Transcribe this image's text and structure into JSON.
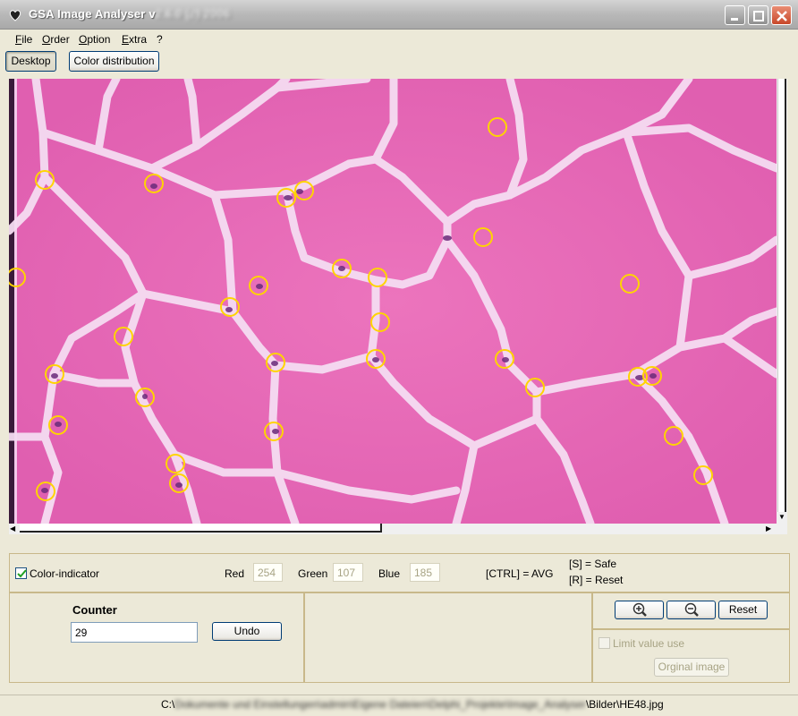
{
  "window": {
    "title_prefix": "GSA Image Analyser v",
    "title_suffix_obscured": "2.6.0 (c) 2006",
    "icon": "app-logo-icon"
  },
  "menu": {
    "items": [
      {
        "accel": "F",
        "rest": "ile"
      },
      {
        "accel": "O",
        "rest": "rder"
      },
      {
        "accel": "O",
        "rest": "ption"
      },
      {
        "accel": "E",
        "rest": "xtra"
      },
      {
        "accel": "",
        "rest": "?"
      }
    ]
  },
  "tabs": {
    "desktop": "Desktop",
    "color_distribution": "Color distribution"
  },
  "color_panel": {
    "indicator_label": "Color-indicator",
    "indicator_checked": true,
    "red_label": "Red",
    "red_value": "254",
    "green_label": "Green",
    "green_value": "107",
    "blue_label": "Blue",
    "blue_value": "185",
    "ctrl_hint": "[CTRL] = AVG",
    "safe_hint": "[S] = Safe",
    "reset_hint": "[R] = Reset"
  },
  "counter": {
    "title": "Counter",
    "value": "29",
    "undo_label": "Undo"
  },
  "zoom": {
    "zoom_in_icon": "zoom-in-icon",
    "zoom_out_icon": "zoom-out-icon",
    "reset_label": "Reset",
    "limit_label": "Limit value use",
    "limit_checked": false,
    "original_label": "Orginal image"
  },
  "status": {
    "path_prefix": "C:\\",
    "path_obscured": "Dokumente und Einstellungen\\admin\\Eigene Dateien\\Delphi_Projekte\\Image_Analyser",
    "path_suffix": "\\Bilder\\HE48.jpg"
  },
  "markers": {
    "count": 29,
    "color": "#ffd400"
  },
  "colors": {
    "tissue": "#e86eb8",
    "membrane": "#f3d7f0",
    "nucleus": "#6a2a7a"
  }
}
